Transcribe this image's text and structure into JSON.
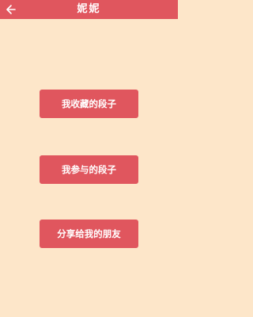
{
  "header": {
    "title": "妮妮",
    "back_icon": "chevron-left-icon"
  },
  "colors": {
    "accent": "#e0565e",
    "background": "#fde6c9",
    "text_on_accent": "#ffffff"
  },
  "menu": {
    "buttons": [
      {
        "label": "我收藏的段子"
      },
      {
        "label": "我参与的段子"
      },
      {
        "label": "分享给我的朋友"
      }
    ]
  }
}
